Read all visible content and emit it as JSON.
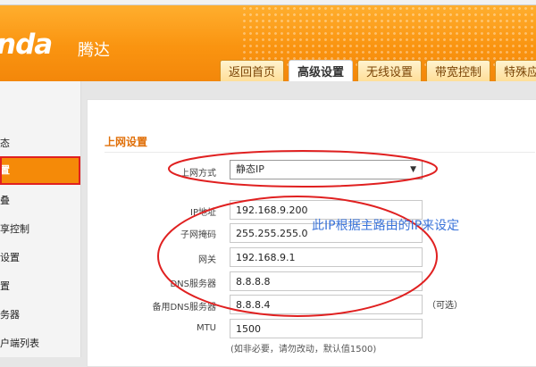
{
  "header": {
    "logo_text": "nda",
    "logo_cn": "腾达",
    "accent": "#f7900f"
  },
  "tabs": [
    {
      "label": "返回首页"
    },
    {
      "label": "高级设置"
    },
    {
      "label": "无线设置"
    },
    {
      "label": "带宽控制"
    },
    {
      "label": "特殊应"
    }
  ],
  "sidebar": {
    "items": [
      {
        "label": "态"
      },
      {
        "label": "置"
      },
      {
        "label": "叠"
      },
      {
        "label": "享控制"
      },
      {
        "label": "设置"
      },
      {
        "label": "置"
      },
      {
        "label": "务器"
      },
      {
        "label": "户端列表"
      }
    ]
  },
  "section": {
    "title": "上网设置"
  },
  "form": {
    "mode_label": "上网方式",
    "mode_value": "静态IP",
    "ip_label": "IP地址",
    "ip_value": "192.168.9.200",
    "mask_label": "子网掩码",
    "mask_value": "255.255.255.0",
    "gateway_label": "网关",
    "gateway_value": "192.168.9.1",
    "dns_label": "DNS服务器",
    "dns_value": "8.8.8.8",
    "dns2_label": "备用DNS服务器",
    "dns2_value": "8.8.8.4",
    "optional_text": "（可选）",
    "mtu_label": "MTU",
    "mtu_value": "1500",
    "mtu_hint": "(如非必要，请勿改动，默认值1500)"
  },
  "annotation": {
    "note": "此IP根据主路由的IP来设定",
    "color": "#e02020"
  }
}
